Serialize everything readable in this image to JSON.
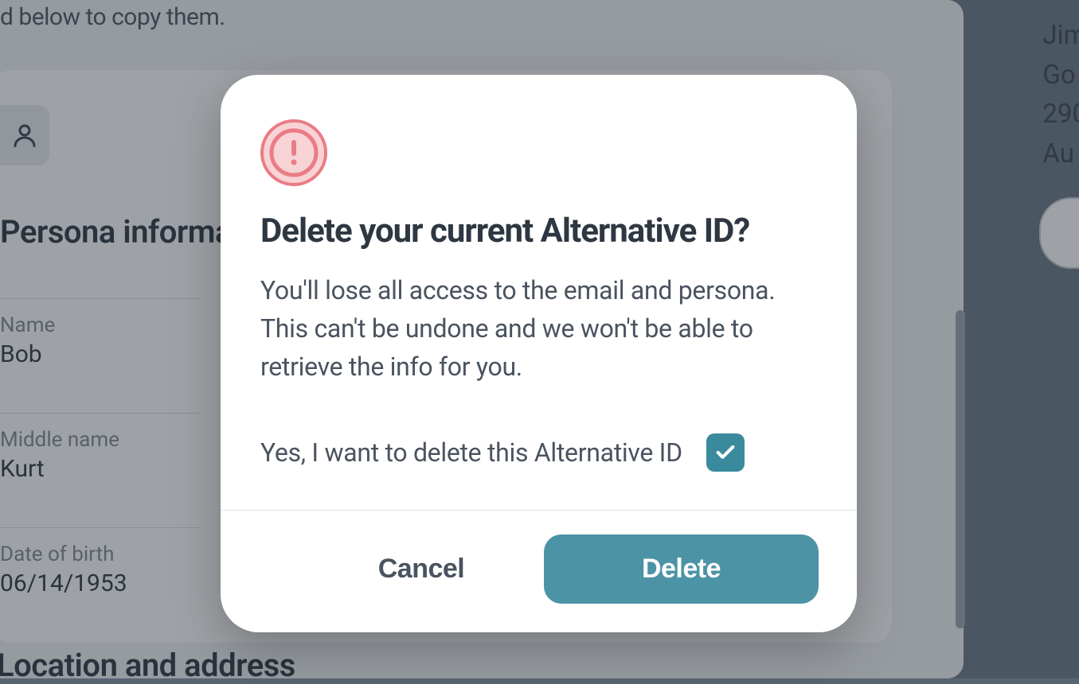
{
  "background": {
    "hint_suffix": "d below to copy them.",
    "section_persona": "Persona informa",
    "section_location": "Location and address",
    "fields": {
      "name": {
        "label": "Name",
        "value": "Bob"
      },
      "middle": {
        "label": "Middle name",
        "value": "Kurt"
      },
      "dob": {
        "label": "Date of birth",
        "value": "06/14/1953"
      }
    },
    "right_lines": [
      "Jim",
      "Go",
      "290",
      "Au"
    ]
  },
  "modal": {
    "title": "Delete your current Alternative ID?",
    "body": "You'll lose all access to the email and persona. This can't be undone and we won't be able to retrieve the info for you.",
    "confirm_label": "Yes, I want to delete this Alternative ID",
    "confirm_checked": true,
    "cancel_label": "Cancel",
    "delete_label": "Delete"
  }
}
